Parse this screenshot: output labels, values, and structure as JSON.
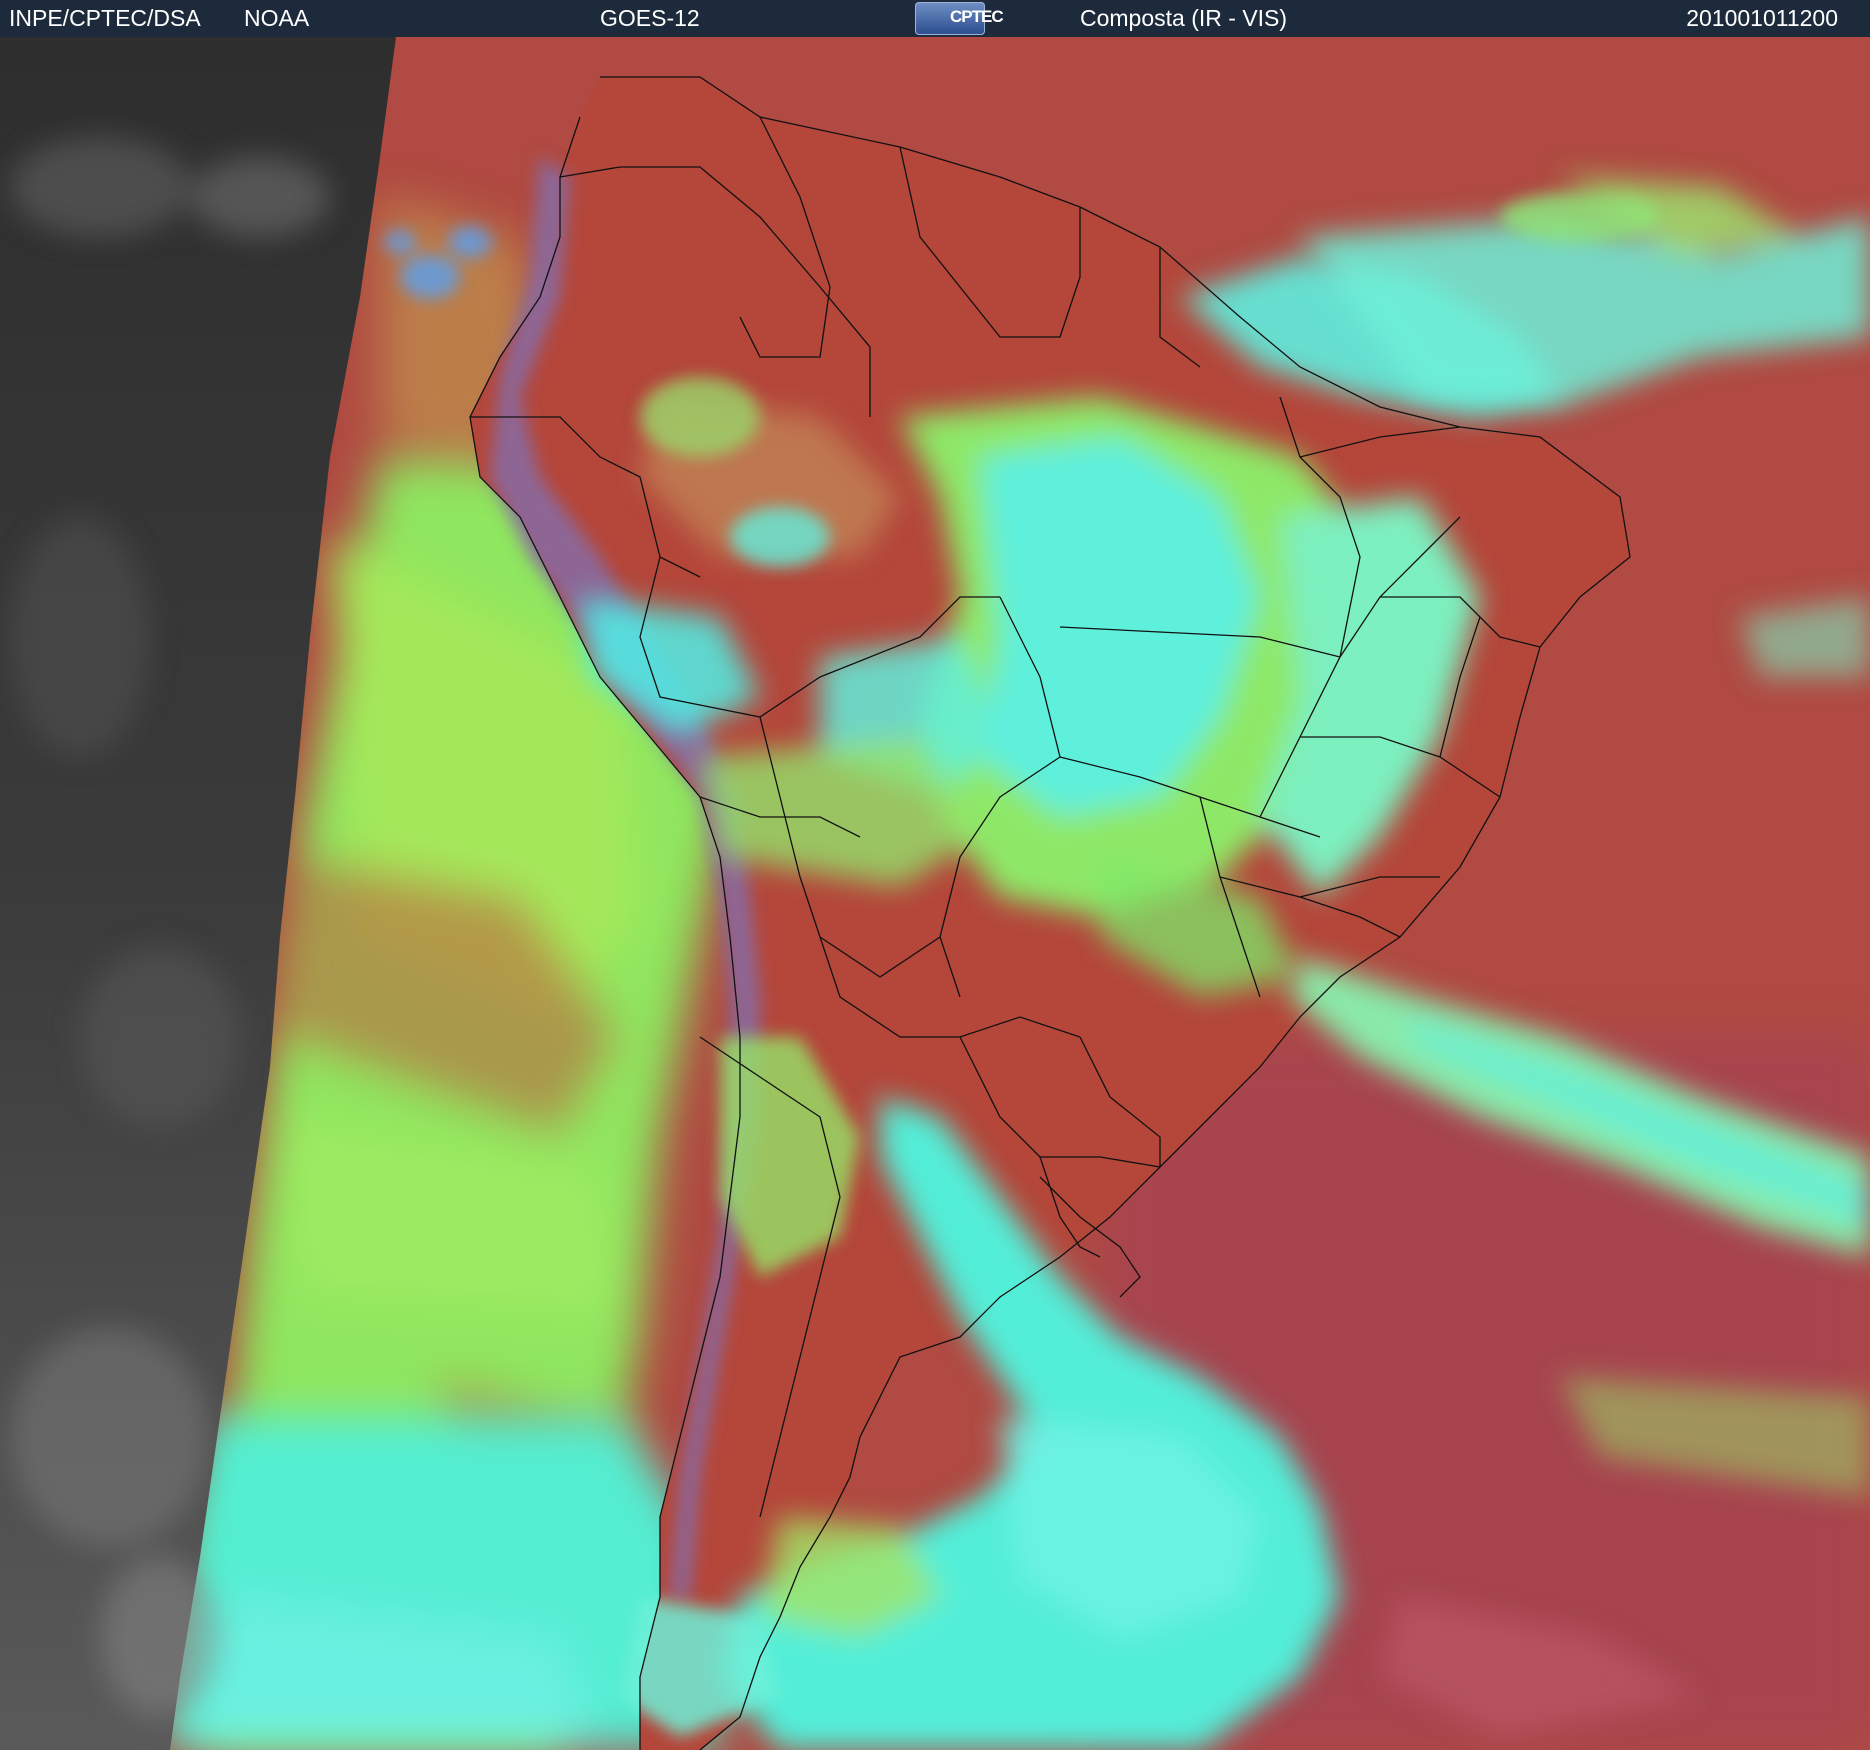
{
  "header": {
    "agency": "INPE/CPTEC/DSA",
    "provider": "NOAA",
    "satellite": "GOES-12",
    "logo_text": "CPTEC",
    "product": "Composta (IR - VIS)",
    "timestamp": "201001011200"
  },
  "colors": {
    "header_bg": "#1c2a3c",
    "land_clear": "#b3473b",
    "ocean_clear": "#b04a42",
    "low_cloud": "#8ee860",
    "high_cloud": "#4ff0e8",
    "night_side": "#3a3a3a",
    "borders": "#111111"
  }
}
